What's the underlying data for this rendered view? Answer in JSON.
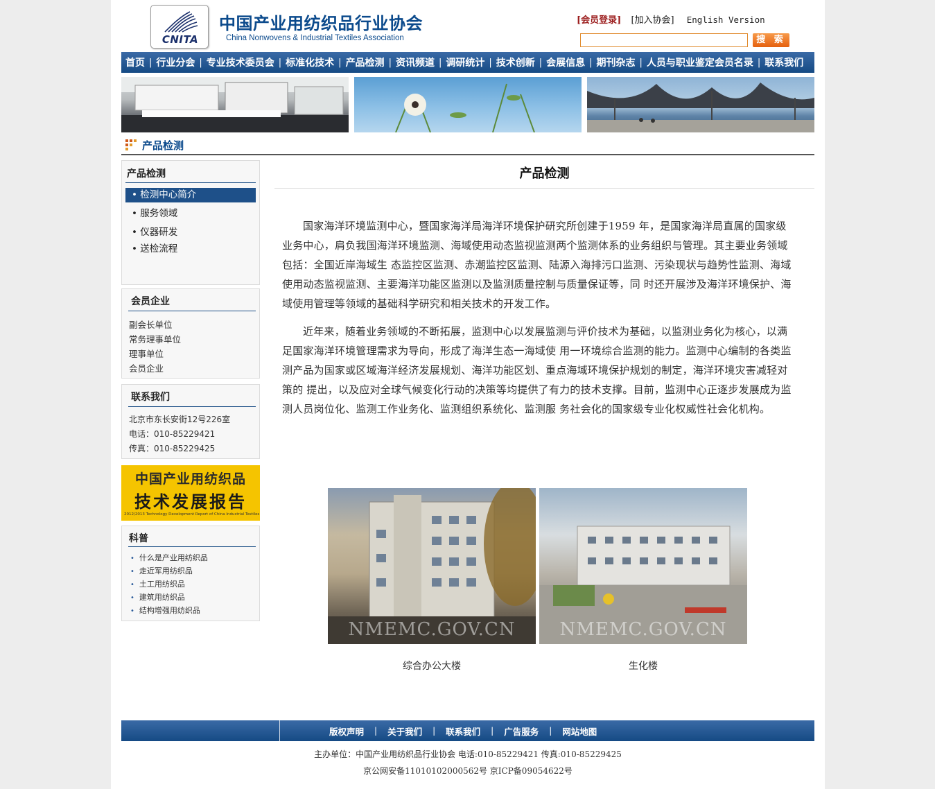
{
  "header": {
    "logo_abbr": "CNITA",
    "title_cn": "中国产业用纺织品行业协会",
    "title_en": "China Nonwovens & Industrial Textiles Association",
    "login_link": "[会员登录]",
    "join_link": "[加入协会]",
    "english_link": "English Version",
    "search_placeholder": "",
    "search_button": "搜 索"
  },
  "nav": {
    "items": [
      "首页",
      "行业分会",
      "专业技术委员会",
      "标准化技术",
      "产品检测",
      "资讯频道",
      "调研统计",
      "技术创新",
      "会展信息",
      "期刊杂志",
      "人员与职业鉴定会员名录",
      "联系我们"
    ]
  },
  "section_title": "产品检测",
  "sidebar": {
    "product": {
      "title": "产品检测",
      "items": [
        "检测中心简介",
        "服务领域",
        "仪器研发",
        "送检流程"
      ],
      "active_index": 0
    },
    "members": {
      "title": "会员企业",
      "items": [
        "副会长单位",
        "常务理事单位",
        "理事单位",
        "会员企业"
      ]
    },
    "contact": {
      "title": "联系我们",
      "address": "北京市东长安街12号226室",
      "phone": "电话：010-85229421",
      "fax": "传真：010-85229425"
    },
    "report_banner": {
      "line1": "中国产业用纺织品",
      "line2": "技术发展报告",
      "line3": "2012/2013 Technology Development Report of China Industrial Textiles"
    },
    "kepu": {
      "title": "科普",
      "items": [
        "什么是产业用纺织品",
        "走近军用纺织品",
        "土工用纺织品",
        "建筑用纺织品",
        "结构增强用纺织品"
      ]
    }
  },
  "content": {
    "title": "产品检测",
    "paragraphs": [
      "国家海洋环境监测中心，暨国家海洋局海洋环境保护研究所创建于1959 年，是国家海洋局直属的国家级业务中心，肩负我国海洋环境监测、海域使用动态监视监测两个监测体系的业务组织与管理。其主要业务领域包括：全国近岸海域生 态监控区监测、赤潮监控区监测、陆源入海排污口监测、污染现状与趋势性监测、海域使用动态监视监测、主要海洋功能区监测以及监测质量控制与质量保证等，同 时还开展涉及海洋环境保护、海域使用管理等领域的基础科学研究和相关技术的开发工作。",
      "近年来，随着业务领域的不断拓展，监测中心以发展监测与评价技术为基础，以监测业务化为核心，以满足国家海洋环境管理需求为导向，形成了海洋生态一海域使 用一环境综合监测的能力。监测中心编制的各类监测产品为国家或区域海洋经济发展规划、海洋功能区划、重点海域环境保护规划的制定，海洋环境灾害减轻对策的 提出，以及应对全球气候变化行动的决策等均提供了有力的技术支撑。目前，监测中心正逐步发展成为监测人员岗位化、监测工作业务化、监测组织系统化、监测服 务社会化的国家级专业化权威性社会化机构。"
    ],
    "photos": [
      {
        "watermark": "NMEMC.GOV.CN",
        "caption": "综合办公大楼"
      },
      {
        "watermark": "NMEMC.GOV.CN",
        "caption": "生化楼"
      }
    ]
  },
  "footer": {
    "links": [
      "版权声明",
      "关于我们",
      "联系我们",
      "广告服务",
      "网站地图"
    ],
    "line1": "主办单位：中国产业用纺织品行业协会 电话:010-85229421 传真:010-85229425",
    "line2": "京公网安备11010102000562号 京ICP备09054622号"
  },
  "colors": {
    "nav_blue": "#1e5089",
    "title_blue": "#0b4a8c",
    "login_red": "#9b1c1c",
    "search_orange": "#e5600e",
    "report_yellow": "#f5c400"
  }
}
